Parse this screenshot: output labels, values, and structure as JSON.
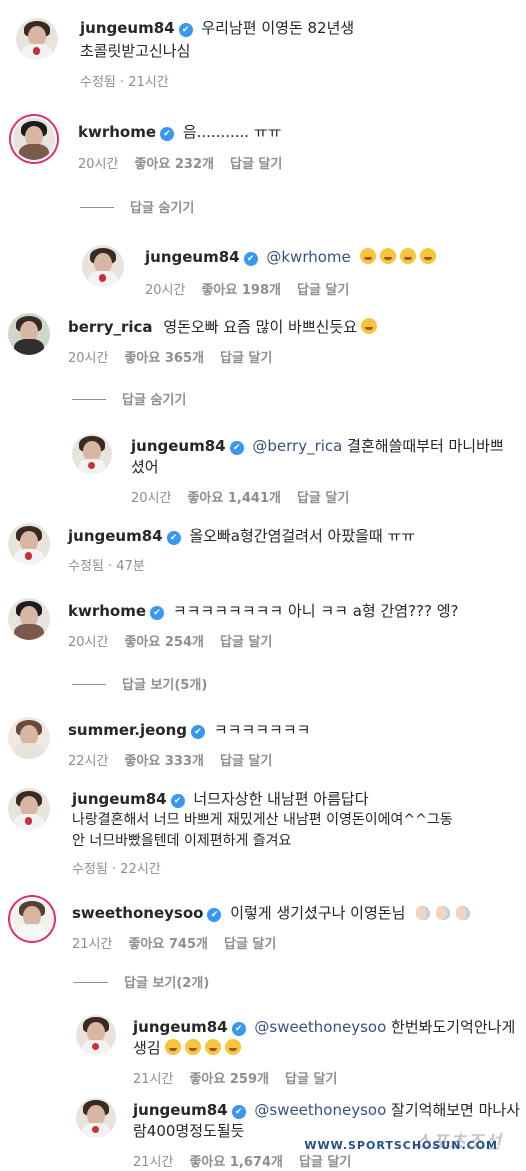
{
  "verified_mark": "✔",
  "comments": [
    {
      "user": "jungeum84",
      "text": "우리남편 이영돈 82년생",
      "text2": "초콜릿받고신나심",
      "time": "수정됨 · 21시간"
    },
    {
      "user": "kwrhome",
      "text": "음........... ㅠㅠ",
      "time": "20시간",
      "likes": "좋아요 232개",
      "reply": "답글 달기"
    },
    {
      "toggle": "답글 숨기기"
    },
    {
      "user": "jungeum84",
      "mention": "@kwrhome",
      "time": "20시간",
      "likes": "좋아요 198개",
      "reply": "답글 달기"
    },
    {
      "user": "berry_rica",
      "text": "영돈오빠 요즘 많이 바쁘신듯요",
      "time": "20시간",
      "likes": "좋아요 365개",
      "reply": "답글 달기"
    },
    {
      "toggle": "답글 숨기기"
    },
    {
      "user": "jungeum84",
      "mention": "@berry_rica",
      "text": "결혼해쓸때부터 마니바쁘",
      "text2": "셨어",
      "time": "20시간",
      "likes": "좋아요 1,441개",
      "reply": "답글 달기"
    },
    {
      "user": "jungeum84",
      "text": "올오빠a형간염걸려서 아팠을때 ㅠㅠ",
      "time": "수정됨 · 47분"
    },
    {
      "user": "kwrhome",
      "text": "ㅋㅋㅋㅋㅋㅋㅋㅋ 아니 ㅋㅋ a형 간염??? 엥?",
      "time": "20시간",
      "likes": "좋아요 254개",
      "reply": "답글 달기"
    },
    {
      "toggle": "답글 보기(5개)"
    },
    {
      "user": "summer.jeong",
      "text": "ㅋㅋㅋㅋㅋㅋㅋ",
      "time": "22시간",
      "likes": "좋아요 333개",
      "reply": "답글 달기"
    },
    {
      "user": "jungeum84",
      "text": "너므자상한 내남편 아름답다",
      "text2": "나랑결혼해서 너므 바쁘게 재밌게산 내남편 이영돈이에여^^그동",
      "text3": "안 너므바빴을텐데 이제편하게 즐겨요",
      "time": "수정됨 · 22시간"
    },
    {
      "user": "sweethoneysoo",
      "text": "이렇게 생기셨구나 이영돈님",
      "time": "21시간",
      "likes": "좋아요 745개",
      "reply": "답글 달기"
    },
    {
      "toggle": "답글 보기(2개)"
    },
    {
      "user": "jungeum84",
      "mention": "@sweethoneysoo",
      "text": "한번봐도기억안나게",
      "text2": "생김",
      "time": "21시간",
      "likes": "좋아요 259개",
      "reply": "답글 달기"
    },
    {
      "user": "jungeum84",
      "mention": "@sweethoneysoo",
      "text": "잘기억해보면 마나사",
      "text2": "람400명정도될듯",
      "time": "21시간",
      "likes": "좋아요 1,674개",
      "reply": "답글 달기"
    }
  ],
  "watermark": {
    "main": "스포츠조선",
    "url": "WWW.SPORTSCHOSUN.COM"
  }
}
